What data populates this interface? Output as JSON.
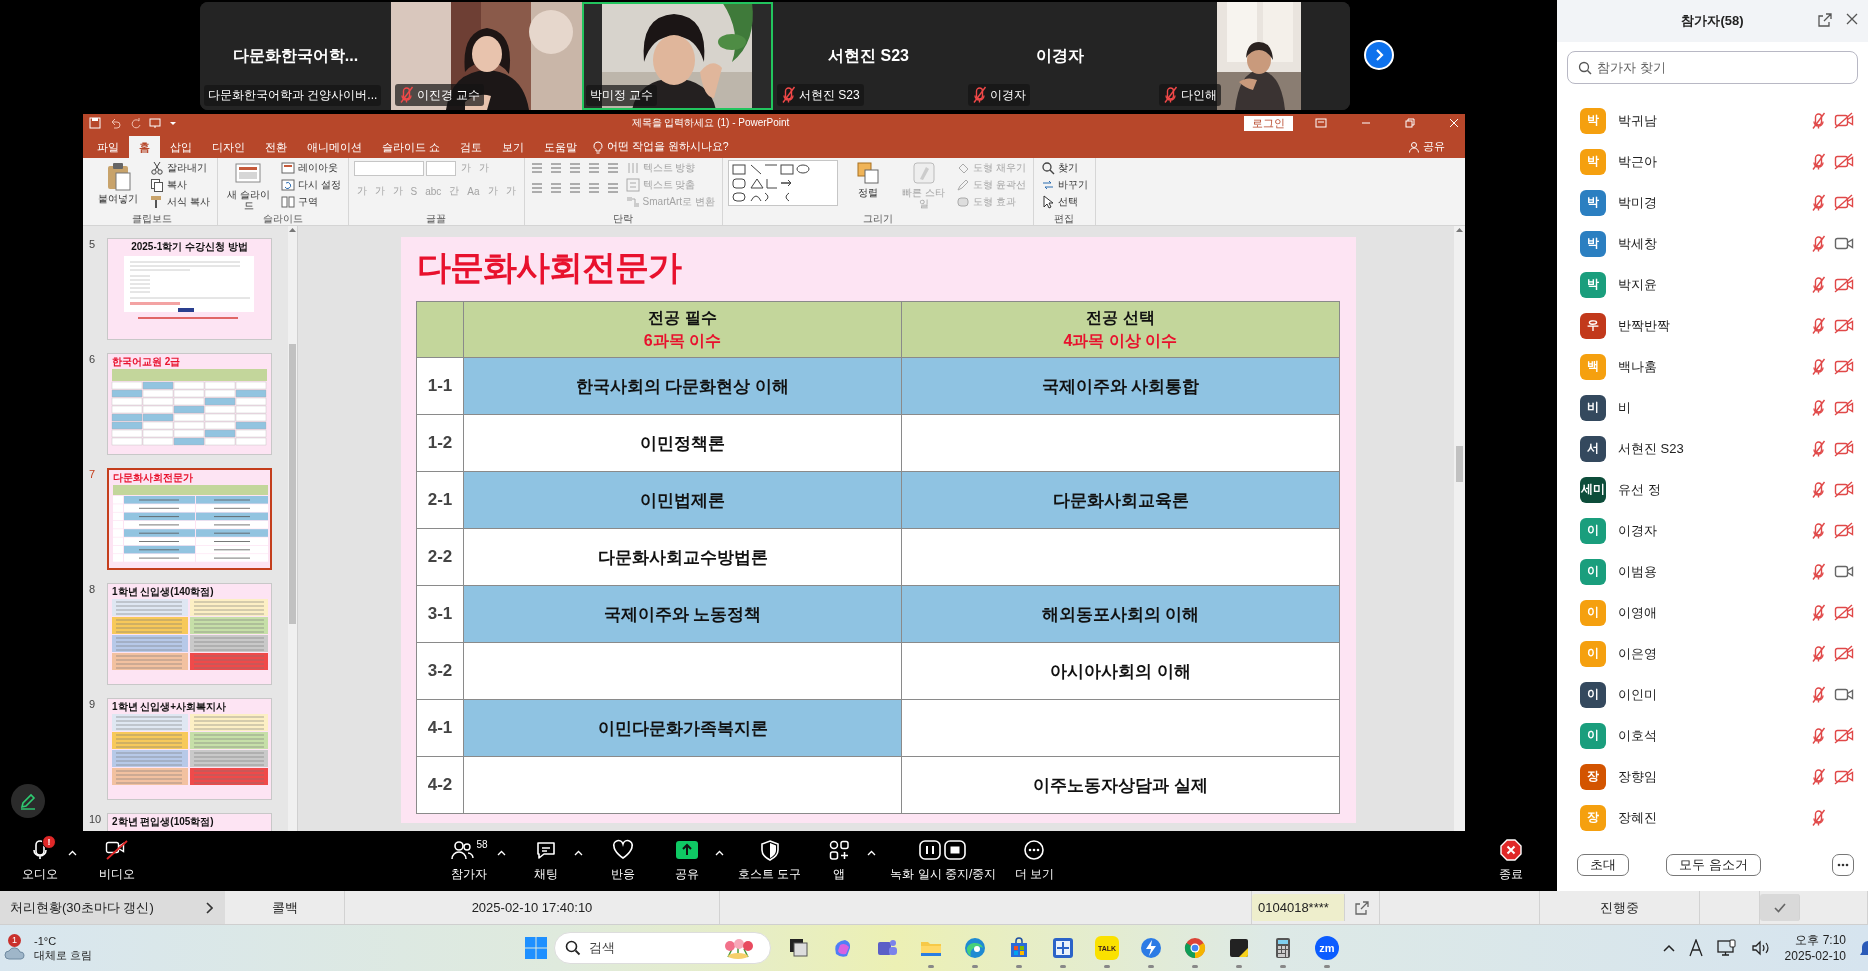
{
  "meeting": {
    "tiles": [
      {
        "kind": "name",
        "title": "다문화한국어학...",
        "label": "다문화한국어학과 건양사이버...",
        "muted": false,
        "selected": false
      },
      {
        "kind": "video",
        "label": "이진경 교수",
        "muted": true,
        "selected": false
      },
      {
        "kind": "video",
        "label": "박미정 교수",
        "muted": false,
        "selected": true
      },
      {
        "kind": "name",
        "title": "서현진 S23",
        "label": "서현진 S23",
        "muted": true,
        "selected": false
      },
      {
        "kind": "name",
        "title": "이경자",
        "label": "이경자",
        "muted": true,
        "selected": false
      },
      {
        "kind": "portrait",
        "label": "다인해",
        "muted": true,
        "selected": false
      }
    ]
  },
  "powerpoint": {
    "title": "제목을 입력하세요 (1) - PowerPoint",
    "login": "로그인",
    "tabs": [
      {
        "label": "파일",
        "selected": false
      },
      {
        "label": "홈",
        "selected": true
      },
      {
        "label": "삽입",
        "selected": false
      },
      {
        "label": "디자인",
        "selected": false
      },
      {
        "label": "전환",
        "selected": false
      },
      {
        "label": "애니메이션",
        "selected": false
      },
      {
        "label": "슬라이드 쇼",
        "selected": false
      },
      {
        "label": "검토",
        "selected": false
      },
      {
        "label": "보기",
        "selected": false
      },
      {
        "label": "도움말",
        "selected": false
      }
    ],
    "tell_me": "어떤 작업을 원하시나요?",
    "share": "공유",
    "ribbon": [
      {
        "label": "클립보드",
        "kind": "stack",
        "items": [
          {
            "kind": "large",
            "text": "붙여넣기",
            "disabled": false
          },
          {
            "kind": "small",
            "text": "잘라내기",
            "disabled": false
          },
          {
            "kind": "small",
            "text": "복사",
            "disabled": false
          },
          {
            "kind": "small",
            "text": "서식 복사",
            "disabled": false
          }
        ]
      },
      {
        "label": "슬라이드",
        "kind": "stack",
        "items": [
          {
            "kind": "large",
            "text": "새 슬라이드",
            "disabled": false
          },
          {
            "kind": "small",
            "text": "레이아웃",
            "disabled": false
          },
          {
            "kind": "small",
            "text": "다시 설정",
            "disabled": false
          },
          {
            "kind": "small",
            "text": "구역",
            "disabled": false
          }
        ]
      },
      {
        "label": "글꼴",
        "kind": "font",
        "disabled": true,
        "glyphs_top": [
          "가",
          "가"
        ],
        "glyphs_bottom": [
          "가",
          "가",
          "가",
          "S",
          "abc",
          "간",
          "Aa",
          "가",
          "가"
        ]
      },
      {
        "label": "단락",
        "kind": "paragraph",
        "items": [
          {
            "kind": "small",
            "text": "텍스트 방향",
            "disabled": true
          },
          {
            "kind": "small",
            "text": "텍스트 맞춤",
            "disabled": true
          },
          {
            "kind": "small",
            "text": "SmartArt로 변환",
            "disabled": true
          }
        ]
      },
      {
        "label": "그리기",
        "kind": "drawing",
        "items": [
          {
            "kind": "large",
            "text": "정렬",
            "disabled": false
          },
          {
            "kind": "large",
            "text": "빠른 스타일",
            "disabled": true
          },
          {
            "kind": "small",
            "text": "도형 채우기",
            "disabled": true
          },
          {
            "kind": "small",
            "text": "도형 윤곽선",
            "disabled": true
          },
          {
            "kind": "small",
            "text": "도형 효과",
            "disabled": true
          }
        ]
      },
      {
        "label": "편집",
        "kind": "stack",
        "items": [
          {
            "kind": "small",
            "text": "찾기",
            "disabled": false
          },
          {
            "kind": "small",
            "text": "바꾸기",
            "disabled": false
          },
          {
            "kind": "small",
            "text": "선택",
            "disabled": false
          }
        ]
      }
    ],
    "thumbnails": [
      {
        "number": "5",
        "title": "2025-1학기 수강신청 방법",
        "kind": "screenshot",
        "selected": false
      },
      {
        "number": "6",
        "title": "한국어교원 2급",
        "kind": "grid",
        "selected": false
      },
      {
        "number": "7",
        "title": "다문화사회전문가",
        "kind": "table",
        "selected": true
      },
      {
        "number": "8",
        "title": "1학년 신입생(140학점)",
        "kind": "colored",
        "selected": false
      },
      {
        "number": "9",
        "title": "1학년 신입생+사회복지사",
        "kind": "colored",
        "selected": false
      },
      {
        "number": "10",
        "title": "2학년 편입생(105학점)",
        "kind": "cut",
        "selected": false
      }
    ],
    "slide": {
      "title": "다문화사회전문가",
      "columns": [
        {
          "title": "전공 필수",
          "note": "6과목 이수"
        },
        {
          "title": "전공 선택",
          "note": "4과목 이상 이수"
        }
      ],
      "rows": [
        {
          "label": "1-1",
          "cells": [
            {
              "text": "한국사회의 다문화현상 이해",
              "highlighted": true
            },
            {
              "text": "국제이주와 사회통합",
              "highlighted": true
            }
          ]
        },
        {
          "label": "1-2",
          "cells": [
            {
              "text": "이민정책론",
              "highlighted": false
            },
            {
              "highlighted": false
            }
          ]
        },
        {
          "label": "2-1",
          "cells": [
            {
              "text": "이민법제론",
              "highlighted": true
            },
            {
              "text": "다문화사회교육론",
              "highlighted": true
            }
          ]
        },
        {
          "label": "2-2",
          "cells": [
            {
              "text": "다문화사회교수방법론",
              "highlighted": false
            },
            {
              "highlighted": false
            }
          ]
        },
        {
          "label": "3-1",
          "cells": [
            {
              "text": "국제이주와 노동정책",
              "highlighted": true
            },
            {
              "text": "해외동포사회의 이해",
              "highlighted": true
            }
          ]
        },
        {
          "label": "3-2",
          "cells": [
            {
              "highlighted": false
            },
            {
              "text": "아시아사회의 이해",
              "highlighted": false
            }
          ]
        },
        {
          "label": "4-1",
          "cells": [
            {
              "text": "이민다문화가족복지론",
              "highlighted": true
            },
            {
              "highlighted": false
            }
          ]
        },
        {
          "label": "4-2",
          "cells": [
            {
              "highlighted": false
            },
            {
              "text": "이주노동자상담과 실제",
              "highlighted": false
            }
          ]
        }
      ]
    }
  },
  "toolbar": {
    "items": [
      {
        "kind": "audio",
        "label": "오디오",
        "badge": "!",
        "menu": true
      },
      {
        "kind": "video",
        "label": "비디오",
        "on": false,
        "menu": false
      },
      {
        "kind": "participants",
        "label": "참가자",
        "count": "58",
        "menu": true
      },
      {
        "kind": "chat",
        "label": "채팅",
        "menu": true
      },
      {
        "kind": "react",
        "label": "반응",
        "menu": false
      },
      {
        "kind": "share",
        "label": "공유",
        "menu": true
      },
      {
        "kind": "host",
        "label": "호스트 도구",
        "menu": false
      },
      {
        "kind": "apps",
        "label": "앱",
        "menu": true
      },
      {
        "kind": "record",
        "label": "녹화 일시 중지/중지",
        "menu": false
      },
      {
        "kind": "more",
        "label": "더 보기",
        "menu": false
      }
    ],
    "end": "종료"
  },
  "participants": {
    "title": "참가자(58)",
    "search_placeholder": "참가자 찾기",
    "list": [
      {
        "initial": "박",
        "name": "박귀남",
        "color": "#f5a00f",
        "muted": true,
        "video_off": true
      },
      {
        "initial": "박",
        "name": "박근아",
        "color": "#f5a00f",
        "muted": true,
        "video_off": true
      },
      {
        "initial": "박",
        "name": "박미경",
        "color": "#2b7fc1",
        "muted": true,
        "video_off": true
      },
      {
        "initial": "박",
        "name": "박세창",
        "color": "#2b7fc1",
        "muted": true,
        "video_off": false
      },
      {
        "initial": "박",
        "name": "박지윤",
        "color": "#1a9e7d",
        "muted": true,
        "video_off": true
      },
      {
        "initial": "우",
        "name": "반짝반짝",
        "color": "#c2391b",
        "muted": true,
        "video_off": true
      },
      {
        "initial": "백",
        "name": "백나훔",
        "color": "#f5a00f",
        "muted": true,
        "video_off": true
      },
      {
        "initial": "비",
        "name": "비",
        "color": "#34495e",
        "muted": true,
        "video_off": true
      },
      {
        "initial": "서",
        "name": "서현진 S23",
        "color": "#34495e",
        "muted": true,
        "video_off": true
      },
      {
        "initial": "세미",
        "name": "유선 정",
        "color": "#0d4d3a",
        "muted": true,
        "video_off": true
      },
      {
        "initial": "이",
        "name": "이경자",
        "color": "#1a9e7d",
        "muted": true,
        "video_off": true
      },
      {
        "initial": "이",
        "name": "이범용",
        "color": "#1a9e7d",
        "muted": true,
        "video_off": false
      },
      {
        "initial": "이",
        "name": "이영애",
        "color": "#f5a00f",
        "muted": true,
        "video_off": true
      },
      {
        "initial": "이",
        "name": "이은영",
        "color": "#f5a00f",
        "muted": true,
        "video_off": true
      },
      {
        "initial": "이",
        "name": "이인미",
        "color": "#34495e",
        "muted": true,
        "video_off": false
      },
      {
        "initial": "이",
        "name": "이호석",
        "color": "#1a9e7d",
        "muted": true,
        "video_off": true
      },
      {
        "initial": "장",
        "name": "장향임",
        "color": "#d35400",
        "muted": true,
        "video_off": true
      },
      {
        "initial": "장",
        "name": "장혜진",
        "color": "#f5a00f",
        "muted": true
      }
    ],
    "buttons": [
      "초대",
      "모두 음소거"
    ]
  },
  "background_app": {
    "sidebar_item": "처리현황(30초마다 갱신)",
    "cells": [
      "콜백",
      "2025-02-10 17:40:10",
      "0104018****",
      "진행중"
    ]
  },
  "taskbar": {
    "weather": {
      "badge": "1",
      "temperature": "-1°C",
      "condition": "대체로 흐림"
    },
    "search_placeholder": "검색",
    "apps": [
      {
        "kind": "taskview",
        "running": false
      },
      {
        "kind": "copilot",
        "running": false
      },
      {
        "kind": "teams",
        "running": false
      },
      {
        "kind": "folder",
        "running": true
      },
      {
        "kind": "edge",
        "running": true
      },
      {
        "kind": "store",
        "running": true
      },
      {
        "kind": "network",
        "running": true
      },
      {
        "kind": "kakao",
        "label": "TALK",
        "running": true
      },
      {
        "kind": "bolt",
        "running": true
      },
      {
        "kind": "chrome",
        "running": true
      },
      {
        "kind": "sticky",
        "running": true
      },
      {
        "kind": "calculator",
        "running": true
      },
      {
        "kind": "zoom",
        "label": "zm",
        "running": true
      }
    ],
    "time": "오후 7:10",
    "date": "2025-02-10"
  }
}
